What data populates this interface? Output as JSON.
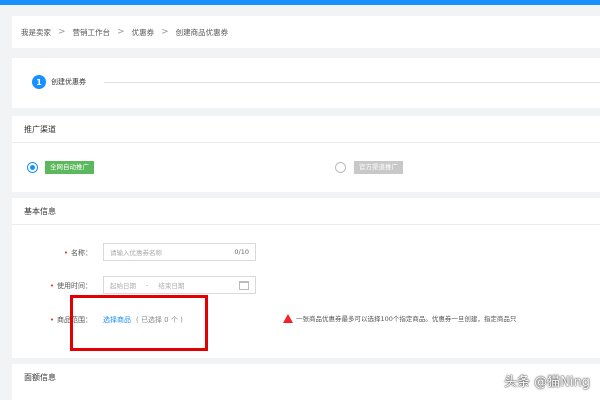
{
  "breadcrumb": {
    "items": [
      "我是卖家",
      "营销工作台",
      "优惠券",
      "创建商品优惠券"
    ],
    "separator": ">"
  },
  "steps": {
    "number": "1",
    "label": "创建优惠券",
    "active_color": "#1890ff"
  },
  "channel": {
    "title": "推广渠道",
    "options": [
      {
        "label": "全网自动推广",
        "selected": true
      },
      {
        "label": "官方渠道推广",
        "selected": false
      }
    ]
  },
  "basic_info": {
    "title": "基本信息",
    "name_label": "名称：",
    "name_placeholder": "请输入优惠券名称",
    "name_counter": "0/10",
    "time_label": "使用时间：",
    "start_placeholder": "起始日期",
    "date_separator": "-",
    "end_placeholder": "结束日期",
    "scope_label": "商品范围：",
    "select_link": "选择商品",
    "selected_count": "( 已选择 0 个 )",
    "warning": "一张商品优惠券最多可以选择100个指定商品。优惠券一旦创建，指定商品只"
  },
  "mail_info": {
    "title": "面额信息"
  },
  "watermark": "头条 @猫Ning",
  "colors": {
    "primary": "#1890ff",
    "tag_green": "#5cb85c",
    "highlight_box": "#e30000",
    "required": "#f5222d"
  }
}
